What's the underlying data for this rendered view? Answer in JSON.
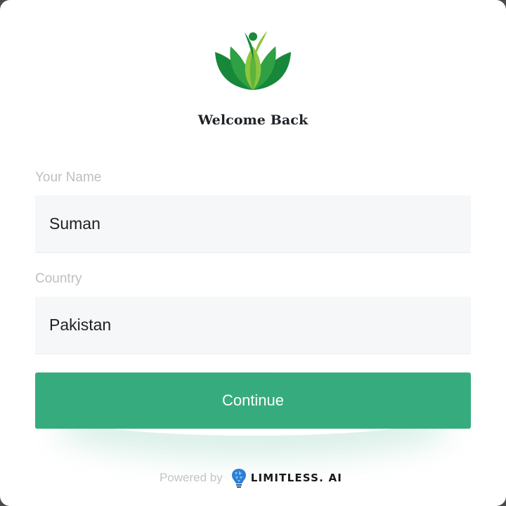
{
  "header": {
    "title": "Welcome Back",
    "logo_icon": "lotus-leaf-icon"
  },
  "form": {
    "name": {
      "label": "Your Name",
      "value": "Suman"
    },
    "country": {
      "label": "Country",
      "value": "Pakistan"
    },
    "continue_label": "Continue"
  },
  "footer": {
    "powered_by": "Powered by",
    "brand": "LIMITLESS. AI",
    "brand_icon": "lightbulb-icon"
  },
  "colors": {
    "accent": "#36ac7e",
    "leaf_dark": "#1a8a3c",
    "leaf_light": "#8cc63f",
    "input_bg": "#f6f7f9",
    "label": "#bdbfc3"
  }
}
